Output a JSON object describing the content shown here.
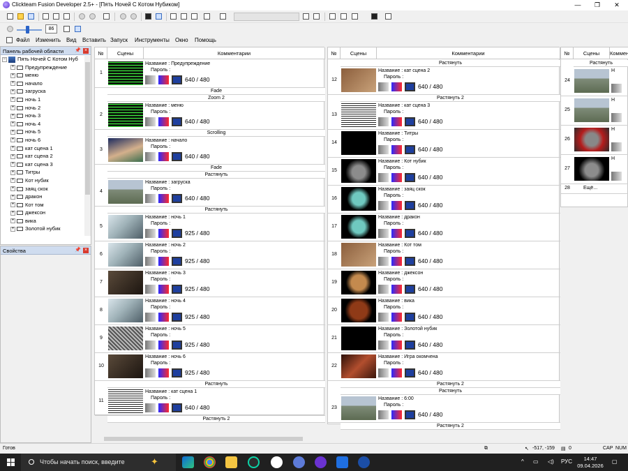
{
  "window": {
    "title": "Clickteam Fusion Developer 2.5+ - [Пять Ночей С Котом Нубиком]",
    "controls": [
      "—",
      "❐",
      "✕"
    ]
  },
  "toolbar": {
    "zoom_value": "86"
  },
  "menu": [
    "Файл",
    "Изменить",
    "Вид",
    "Вставить",
    "Запуск",
    "Инструменты",
    "Окно",
    "Помощь"
  ],
  "workspace": {
    "title": "Панель рабочей области",
    "root": "Пять Ночей С Котом Нуб",
    "items": [
      "Предупреждение",
      "меню",
      "начало",
      "загруска",
      "ночь 1",
      "ночь 2",
      "ночь 3",
      "ночь 4",
      "ночь 5",
      "ночь 6",
      "кат сцена 1",
      "кат сцена 2",
      "кат сцена 3",
      "Титры",
      "Кот нубик",
      "заяц скок",
      "дракон",
      "Кот том",
      "джексон",
      "вика",
      "Золотой нубик"
    ]
  },
  "properties": {
    "title": "Свойства"
  },
  "storyboard": {
    "headers": {
      "num": "№",
      "scenes": "Сцены",
      "comments": "Комментарии"
    },
    "name_prefix": "Название : ",
    "password_label": "Пароль :",
    "frames_col1": [
      {
        "num": "1",
        "name": "Предупреждение",
        "w": "640",
        "h": "480",
        "after": "Fade",
        "thumb": "t-green"
      },
      {
        "num": "2",
        "name": "меню",
        "w": "640",
        "h": "480",
        "before": "Zoom 2",
        "after": "Scrolling",
        "thumb": "t-green"
      },
      {
        "num": "3",
        "name": "начало",
        "w": "640",
        "h": "480",
        "after": "Fade",
        "thumb": "t-room"
      },
      {
        "num": "4",
        "name": "загруска",
        "w": "640",
        "h": "480",
        "before": "Растянуть",
        "after": "Растянуть",
        "thumb": "t-town"
      },
      {
        "num": "5",
        "name": "ночь 1",
        "w": "925",
        "h": "480",
        "thumb": "t-office"
      },
      {
        "num": "6",
        "name": "ночь 2",
        "w": "925",
        "h": "480",
        "thumb": "t-office"
      },
      {
        "num": "7",
        "name": "ночь 3",
        "w": "925",
        "h": "480",
        "thumb": "t-dark"
      },
      {
        "num": "8",
        "name": "ночь 4",
        "w": "925",
        "h": "480",
        "thumb": "t-office"
      },
      {
        "num": "9",
        "name": "ночь 5",
        "w": "925",
        "h": "480",
        "thumb": "t-noise"
      },
      {
        "num": "10",
        "name": "ночь 6",
        "w": "925",
        "h": "480",
        "thumb": "t-dark"
      },
      {
        "num": "11",
        "name": "кат сцена 1",
        "w": "640",
        "h": "480",
        "before": "Растянуть",
        "after": "Растянуть 2",
        "thumb": "t-text"
      }
    ],
    "frames_col2": [
      {
        "num": "12",
        "name": "кат сцена 2",
        "w": "640",
        "h": "480",
        "before": "Растянуть",
        "after": "Растянуть 2",
        "thumb": "t-brown"
      },
      {
        "num": "13",
        "name": "кат сцена 3",
        "w": "640",
        "h": "480",
        "thumb": "t-text"
      },
      {
        "num": "14",
        "name": "Титры",
        "w": "640",
        "h": "480",
        "thumb": "t-black"
      },
      {
        "num": "15",
        "name": "Кот нубик",
        "w": "640",
        "h": "480",
        "thumb": "t-cat"
      },
      {
        "num": "16",
        "name": "заяц скок",
        "w": "640",
        "h": "480",
        "thumb": "t-cyan"
      },
      {
        "num": "17",
        "name": "дракон",
        "w": "640",
        "h": "480",
        "thumb": "t-cyan"
      },
      {
        "num": "18",
        "name": "Кот том",
        "w": "640",
        "h": "480",
        "thumb": "t-brown"
      },
      {
        "num": "19",
        "name": "джексон",
        "w": "640",
        "h": "480",
        "thumb": "t-dog"
      },
      {
        "num": "20",
        "name": "вика",
        "w": "640",
        "h": "480",
        "thumb": "t-red"
      },
      {
        "num": "21",
        "name": "Золотой нубик",
        "w": "640",
        "h": "480",
        "thumb": "t-black"
      },
      {
        "num": "22",
        "name": "Игра окомчена",
        "w": "640",
        "h": "480",
        "after": "Растянуть 2",
        "thumb": "t-redimg"
      },
      {
        "num": "23",
        "name": "6:00",
        "w": "640",
        "h": "480",
        "before": "Растянуть",
        "after": "Растянуть 2",
        "thumb": "t-town"
      }
    ],
    "frames_col3": [
      {
        "num": "24",
        "name": "",
        "thumb": "t-town"
      },
      {
        "num": "25",
        "name": "",
        "thumb": "t-town"
      },
      {
        "num": "26",
        "name": "",
        "thumb": "t-catred"
      },
      {
        "num": "27",
        "name": "",
        "thumb": "t-cat"
      }
    ],
    "more_num": "28",
    "more_label": "Ещё...",
    "col3_before": "Растянуть"
  },
  "status": {
    "ready": "Готов",
    "coords": "-517, -159",
    "zero": "0",
    "caps": "CAP",
    "num": "NUM"
  },
  "taskbar": {
    "search_placeholder": "Чтобы начать поиск, введите",
    "lang": "РУС",
    "time": "14:47",
    "date": "09.04.2026"
  }
}
